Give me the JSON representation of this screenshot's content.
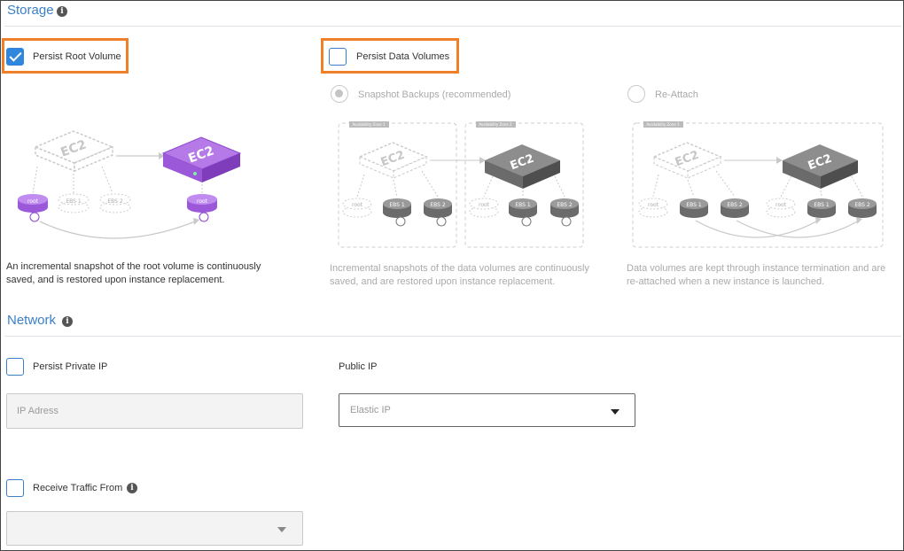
{
  "storage": {
    "title": "Storage",
    "persist_root": {
      "label": "Persist Root Volume",
      "checked": true
    },
    "persist_data": {
      "label": "Persist Data Volumes",
      "checked": false
    },
    "snapshot_backups": {
      "label": "Snapshot Backups (recommended)",
      "selected": true
    },
    "re_attach": {
      "label": "Re-Attach",
      "selected": false
    },
    "root_desc": "An incremental snapshot of the root volume is continuously saved, and is restored upon instance replacement.",
    "snapshot_desc": "Incremental snapshots of the data volumes are continuously saved, and are restored upon instance replacement.",
    "reattach_desc": "Data volumes are kept through instance termination and are re-attached when a new instance is launched.",
    "diagram_labels": {
      "ec2": "EC2",
      "root": "root",
      "ebs1": "EBS 1",
      "ebs2": "EBS 2",
      "availability_zone_1": "Availability Zone 1",
      "availability_zone_2": "Availability Zone 2"
    }
  },
  "network": {
    "title": "Network",
    "persist_private_ip": {
      "label": "Persist Private IP",
      "checked": false
    },
    "ip_address": {
      "placeholder": "IP Adress"
    },
    "public_ip": {
      "label": "Public IP",
      "placeholder": "Elastic IP"
    },
    "receive_traffic": {
      "label": "Receive Traffic From",
      "checked": false
    },
    "traffic_select": {
      "value": ""
    }
  },
  "colors": {
    "accent": "#3a7fc8",
    "checkbox_checked": "#2f87dd",
    "highlight": "#f07f2a",
    "ec2_purple": "#9b59d9",
    "ec2_gray": "#6b6b6b"
  },
  "icons": [
    "info-icon",
    "checkmark-icon",
    "caret-down-icon"
  ]
}
